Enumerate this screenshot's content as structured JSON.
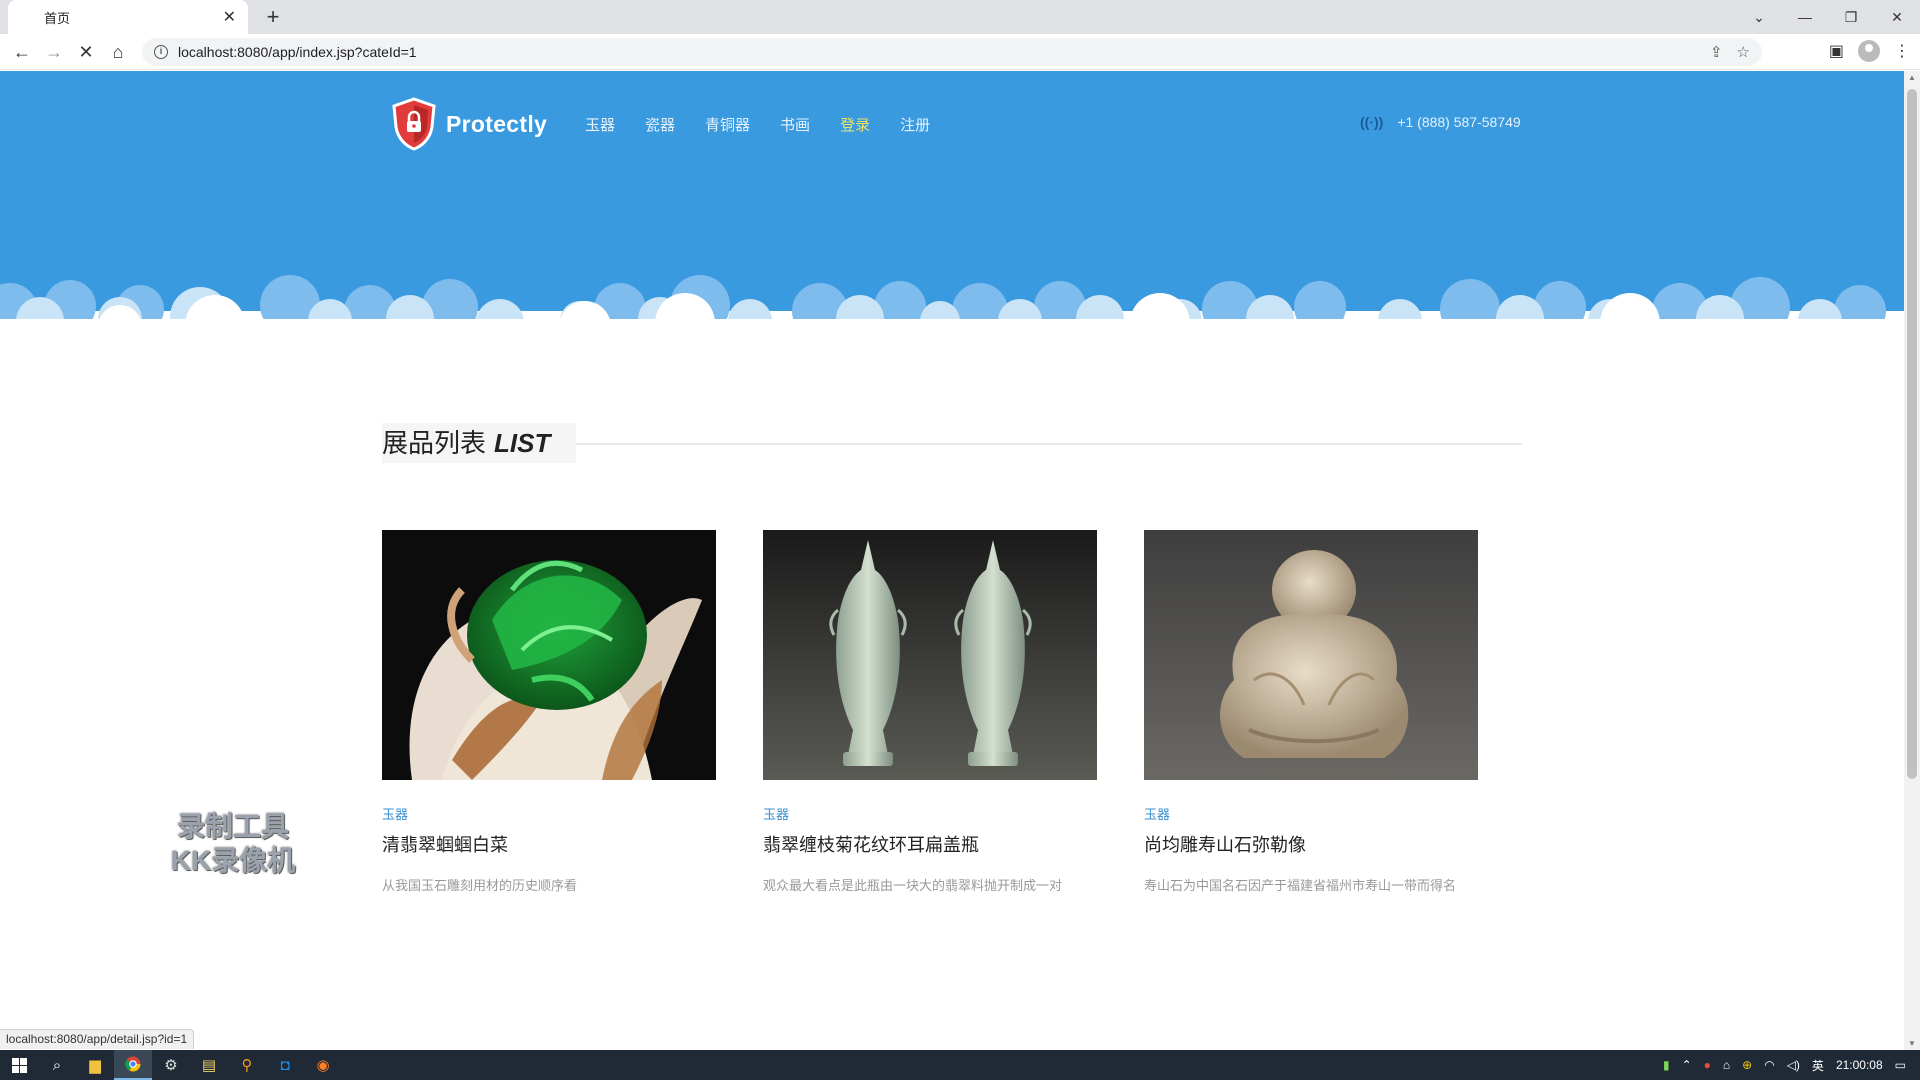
{
  "browser": {
    "tab_title": "首页",
    "url": "localhost:8080/app/index.jsp?cateId=1",
    "status_url": "localhost:8080/app/detail.jsp?id=1"
  },
  "site": {
    "brand": "Protectly",
    "nav": [
      {
        "label": "玉器",
        "active": false
      },
      {
        "label": "瓷器",
        "active": false
      },
      {
        "label": "青铜器",
        "active": false
      },
      {
        "label": "书画",
        "active": false
      },
      {
        "label": "登录",
        "active": true
      },
      {
        "label": "注册",
        "active": false
      }
    ],
    "phone": "+1 (888) 587-58749",
    "accent_color": "#3a9ae0"
  },
  "section": {
    "title": "展品列表",
    "title_en": "LIST"
  },
  "exhibits": [
    {
      "category": "玉器",
      "name": "清翡翠蝈蝈白菜",
      "desc": "从我国玉石雕刻用材的历史顺序看"
    },
    {
      "category": "玉器",
      "name": "翡翠缠枝菊花纹环耳扁盖瓶",
      "desc": "观众最大看点是此瓶由一块大的翡翠料抛开制成一对"
    },
    {
      "category": "玉器",
      "name": "尚均雕寿山石弥勒像",
      "desc": "寿山石为中国名石因产于福建省福州市寿山一带而得名"
    }
  ],
  "watermark": {
    "line1": "录制工具",
    "line2": "KK录像机"
  },
  "taskbar": {
    "ime": "英",
    "time": "21:00:08"
  }
}
